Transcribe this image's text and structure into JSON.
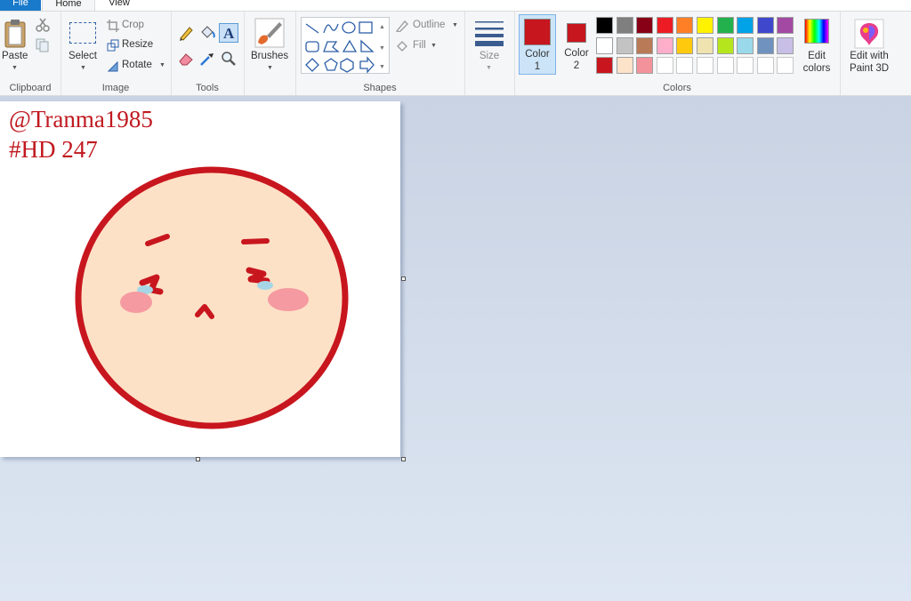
{
  "tabs": {
    "file": "File",
    "home": "Home",
    "view": "View"
  },
  "clipboard": {
    "paste": "Paste",
    "group": "Clipboard"
  },
  "image": {
    "select": "Select",
    "crop": "Crop",
    "resize": "Resize",
    "rotate": "Rotate",
    "group": "Image"
  },
  "tools": {
    "group": "Tools"
  },
  "brushes": {
    "label": "Brushes"
  },
  "shapes": {
    "outline": "Outline",
    "fill": "Fill",
    "group": "Shapes"
  },
  "size": {
    "label": "Size"
  },
  "colors": {
    "color1_line1": "Color",
    "color1_line2": "1",
    "color2_line1": "Color",
    "color2_line2": "2",
    "color1": "#c8161e",
    "color2": "#c8161e",
    "edit_line1": "Edit",
    "edit_line2": "colors",
    "paint3d_line1": "Edit with",
    "paint3d_line2": "Paint 3D",
    "group": "Colors",
    "palette_row1": [
      "#000000",
      "#7f7f7f",
      "#880015",
      "#ed1c24",
      "#ff7f27",
      "#fff200",
      "#22b14c",
      "#00a2e8",
      "#3f48cc",
      "#a349a4"
    ],
    "palette_row2": [
      "#ffffff",
      "#c3c3c3",
      "#b97a57",
      "#ffaec9",
      "#ffc90e",
      "#efe4b0",
      "#b5e61d",
      "#99d9ea",
      "#7092be",
      "#c8bfe7"
    ],
    "palette_row3": [
      "#c8161e",
      "#fde3c9",
      "#f3929b",
      "",
      "",
      "",
      "",
      "",
      "",
      ""
    ]
  },
  "canvas": {
    "line1": "@Tranma1985",
    "line2": "#HD 247"
  }
}
